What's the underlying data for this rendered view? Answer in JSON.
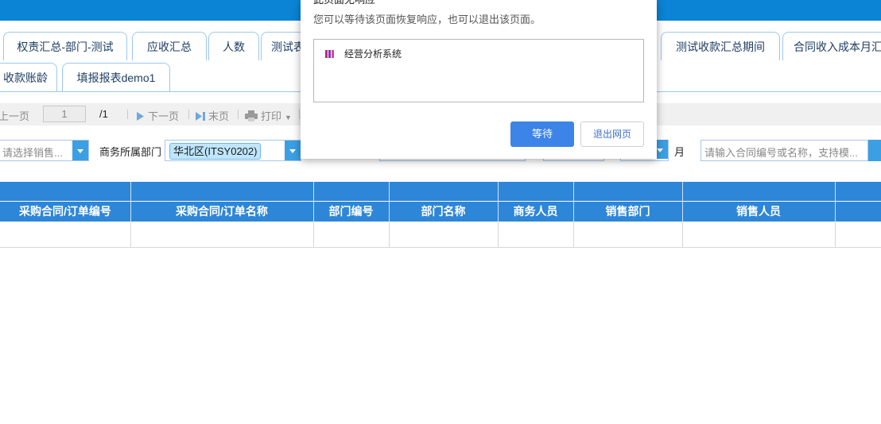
{
  "tabs_row1": [
    "权责汇总-部门-测试",
    "应收汇总",
    "人数",
    "测试表",
    "测试收款汇总期间",
    "合同收入成本月汇"
  ],
  "tabs_row2": [
    "收款账龄",
    "填报报表demo1"
  ],
  "toolbar": {
    "prev": "上一页",
    "page_value": "1",
    "page_total": "/1",
    "next": "下一页",
    "last": "末页",
    "print": "打印"
  },
  "filters": {
    "sales_placeholder": "请选择销售...",
    "dept_label": "商务所属部门",
    "dept_value": "华北区(ITSY0202)",
    "month_label": "月",
    "search_placeholder": "请输入合同编号或名称，支持模..."
  },
  "table": {
    "columns": [
      "采购合同/订单编号",
      "采购合同/订单名称",
      "部门编号",
      "部门名称",
      "商务人员",
      "销售部门",
      "销售人员"
    ]
  },
  "dialog": {
    "title_partial": "此页面无响应",
    "message": "您可以等待该页面恢复响应，也可以退出该页面。",
    "page_item": "经营分析系统",
    "wait_button": "等待",
    "exit_button": "退出网页"
  }
}
